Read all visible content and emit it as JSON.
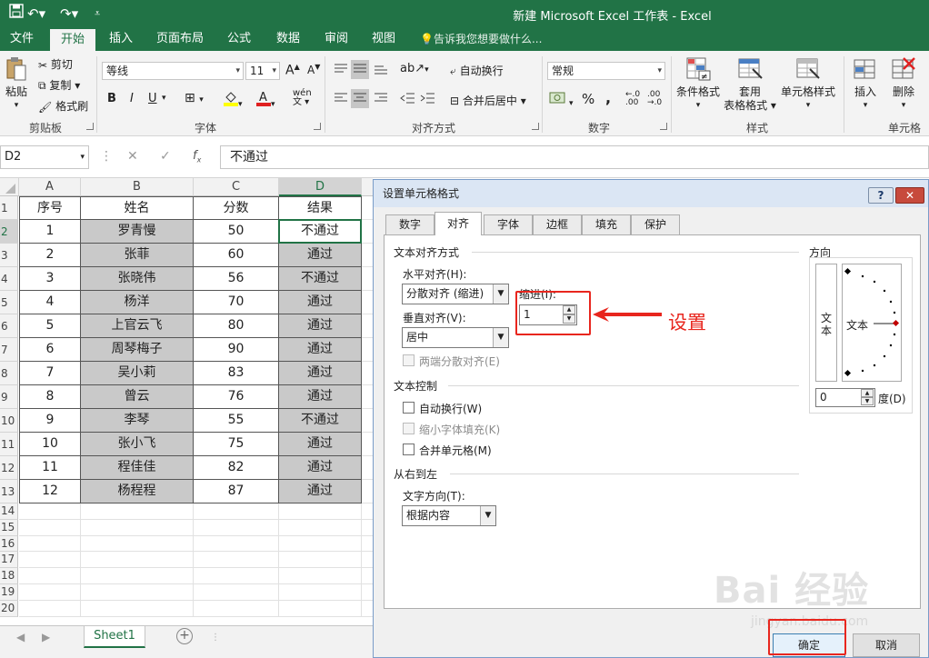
{
  "window_title": "新建 Microsoft Excel 工作表 - Excel",
  "ribbon_tabs": [
    "文件",
    "开始",
    "插入",
    "页面布局",
    "公式",
    "数据",
    "审阅",
    "视图"
  ],
  "tell_me": "告诉我您想要做什么...",
  "ribbon": {
    "paste": "粘贴",
    "cut": "剪切",
    "copy": "复制",
    "format_painter": "格式刷",
    "clipboard_group": "剪贴板",
    "font_name": "等线",
    "font_size": "11",
    "font_group": "字体",
    "bold": "B",
    "italic": "I",
    "underline": "U",
    "wrap_text": "自动换行",
    "merge_center": "合并后居中",
    "align_group": "对齐方式",
    "number_format": "常规",
    "percent": "%",
    "comma": ",",
    "number_group": "数字",
    "cond_format": "条件格式",
    "table_format_1": "套用",
    "table_format_2": "表格格式",
    "cell_styles": "单元格样式",
    "styles_group": "样式",
    "insert": "插入",
    "delete": "删除",
    "cells_group": "单元格"
  },
  "formula_bar": {
    "name_box": "D2",
    "content": "不通过"
  },
  "grid": {
    "col_headers": [
      "A",
      "B",
      "C",
      "D"
    ],
    "header_row": [
      "序号",
      "姓名",
      "分数",
      "结果"
    ],
    "rows": [
      [
        "1",
        "罗青慢",
        "50",
        "不通过"
      ],
      [
        "2",
        "张菲",
        "60",
        "通过"
      ],
      [
        "3",
        "张晓伟",
        "56",
        "不通过"
      ],
      [
        "4",
        "杨洋",
        "70",
        "通过"
      ],
      [
        "5",
        "上官云飞",
        "80",
        "通过"
      ],
      [
        "6",
        "周琴梅子",
        "90",
        "通过"
      ],
      [
        "7",
        "吴小莉",
        "83",
        "通过"
      ],
      [
        "8",
        "曾云",
        "76",
        "通过"
      ],
      [
        "9",
        "李琴",
        "55",
        "不通过"
      ],
      [
        "10",
        "张小飞",
        "75",
        "通过"
      ],
      [
        "11",
        "程佳佳",
        "82",
        "通过"
      ],
      [
        "12",
        "杨程程",
        "87",
        "通过"
      ]
    ],
    "row_numbers": [
      "1",
      "2",
      "3",
      "4",
      "5",
      "6",
      "7",
      "8",
      "9",
      "10",
      "11",
      "12",
      "13",
      "14",
      "15",
      "16",
      "17",
      "18",
      "19",
      "20"
    ]
  },
  "sheet_tab": "Sheet1",
  "dialog": {
    "title": "设置单元格格式",
    "help": "?",
    "tabs": [
      "数字",
      "对齐",
      "字体",
      "边框",
      "填充",
      "保护"
    ],
    "text_align_section": "文本对齐方式",
    "horizontal_label": "水平对齐(H):",
    "horizontal_value": "分散对齐 (缩进)",
    "indent_label": "缩进(I):",
    "indent_value": "1",
    "vertical_label": "垂直对齐(V):",
    "vertical_value": "居中",
    "justify_distributed": "两端分散对齐(E)",
    "text_control_section": "文本控制",
    "wrap_text": "自动换行(W)",
    "shrink_to_fit": "缩小字体填充(K)",
    "merge_cells": "合并单元格(M)",
    "rtl_section": "从右到左",
    "text_direction_label": "文字方向(T):",
    "text_direction_value": "根据内容",
    "orientation_section": "方向",
    "vertical_text": "文本",
    "orientation_text": "文本",
    "degree_value": "0",
    "degree_label": "度(D)",
    "ok": "确定",
    "cancel": "取消"
  },
  "annotation": "设置",
  "watermark_1": "Bai 经验",
  "watermark_2": "jingyan.baidu.com"
}
